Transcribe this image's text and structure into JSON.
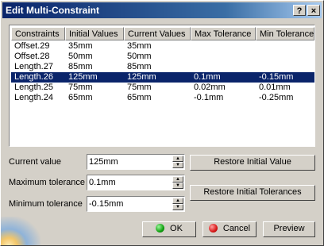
{
  "window": {
    "title": "Edit Multi-Constraint",
    "help_label": "?",
    "close_label": "×"
  },
  "table": {
    "columns": [
      "Constraints",
      "Initial Values",
      "Current Values",
      "Max Tolerance",
      "Min Tolerance"
    ],
    "rows": [
      [
        "Offset.29",
        "35mm",
        "35mm",
        "",
        ""
      ],
      [
        "Offset.28",
        "50mm",
        "50mm",
        "",
        ""
      ],
      [
        "Length.27",
        "85mm",
        "85mm",
        "",
        ""
      ],
      [
        "Length.26",
        "125mm",
        "125mm",
        "0.1mm",
        "-0.15mm"
      ],
      [
        "Length.25",
        "75mm",
        "75mm",
        "0.02mm",
        "0.01mm"
      ],
      [
        "Length.24",
        "65mm",
        "65mm",
        "-0.1mm",
        "-0.25mm"
      ]
    ],
    "selected_row_index": 3
  },
  "fields": {
    "current_value": {
      "label": "Current value",
      "value": "125mm"
    },
    "maximum_tolerance": {
      "label": "Maximum tolerance",
      "value": "0.1mm"
    },
    "minimum_tolerance": {
      "label": "Minimum tolerance",
      "value": "-0.15mm"
    }
  },
  "buttons": {
    "restore_initial_value": "Restore Initial Value",
    "restore_initial_tolerances": "Restore Initial Tolerances",
    "ok": "OK",
    "cancel": "Cancel",
    "preview": "Preview"
  },
  "colors": {
    "selection": "#0a246a",
    "ok_icon": "#10a010",
    "cancel_icon": "#d81818"
  }
}
